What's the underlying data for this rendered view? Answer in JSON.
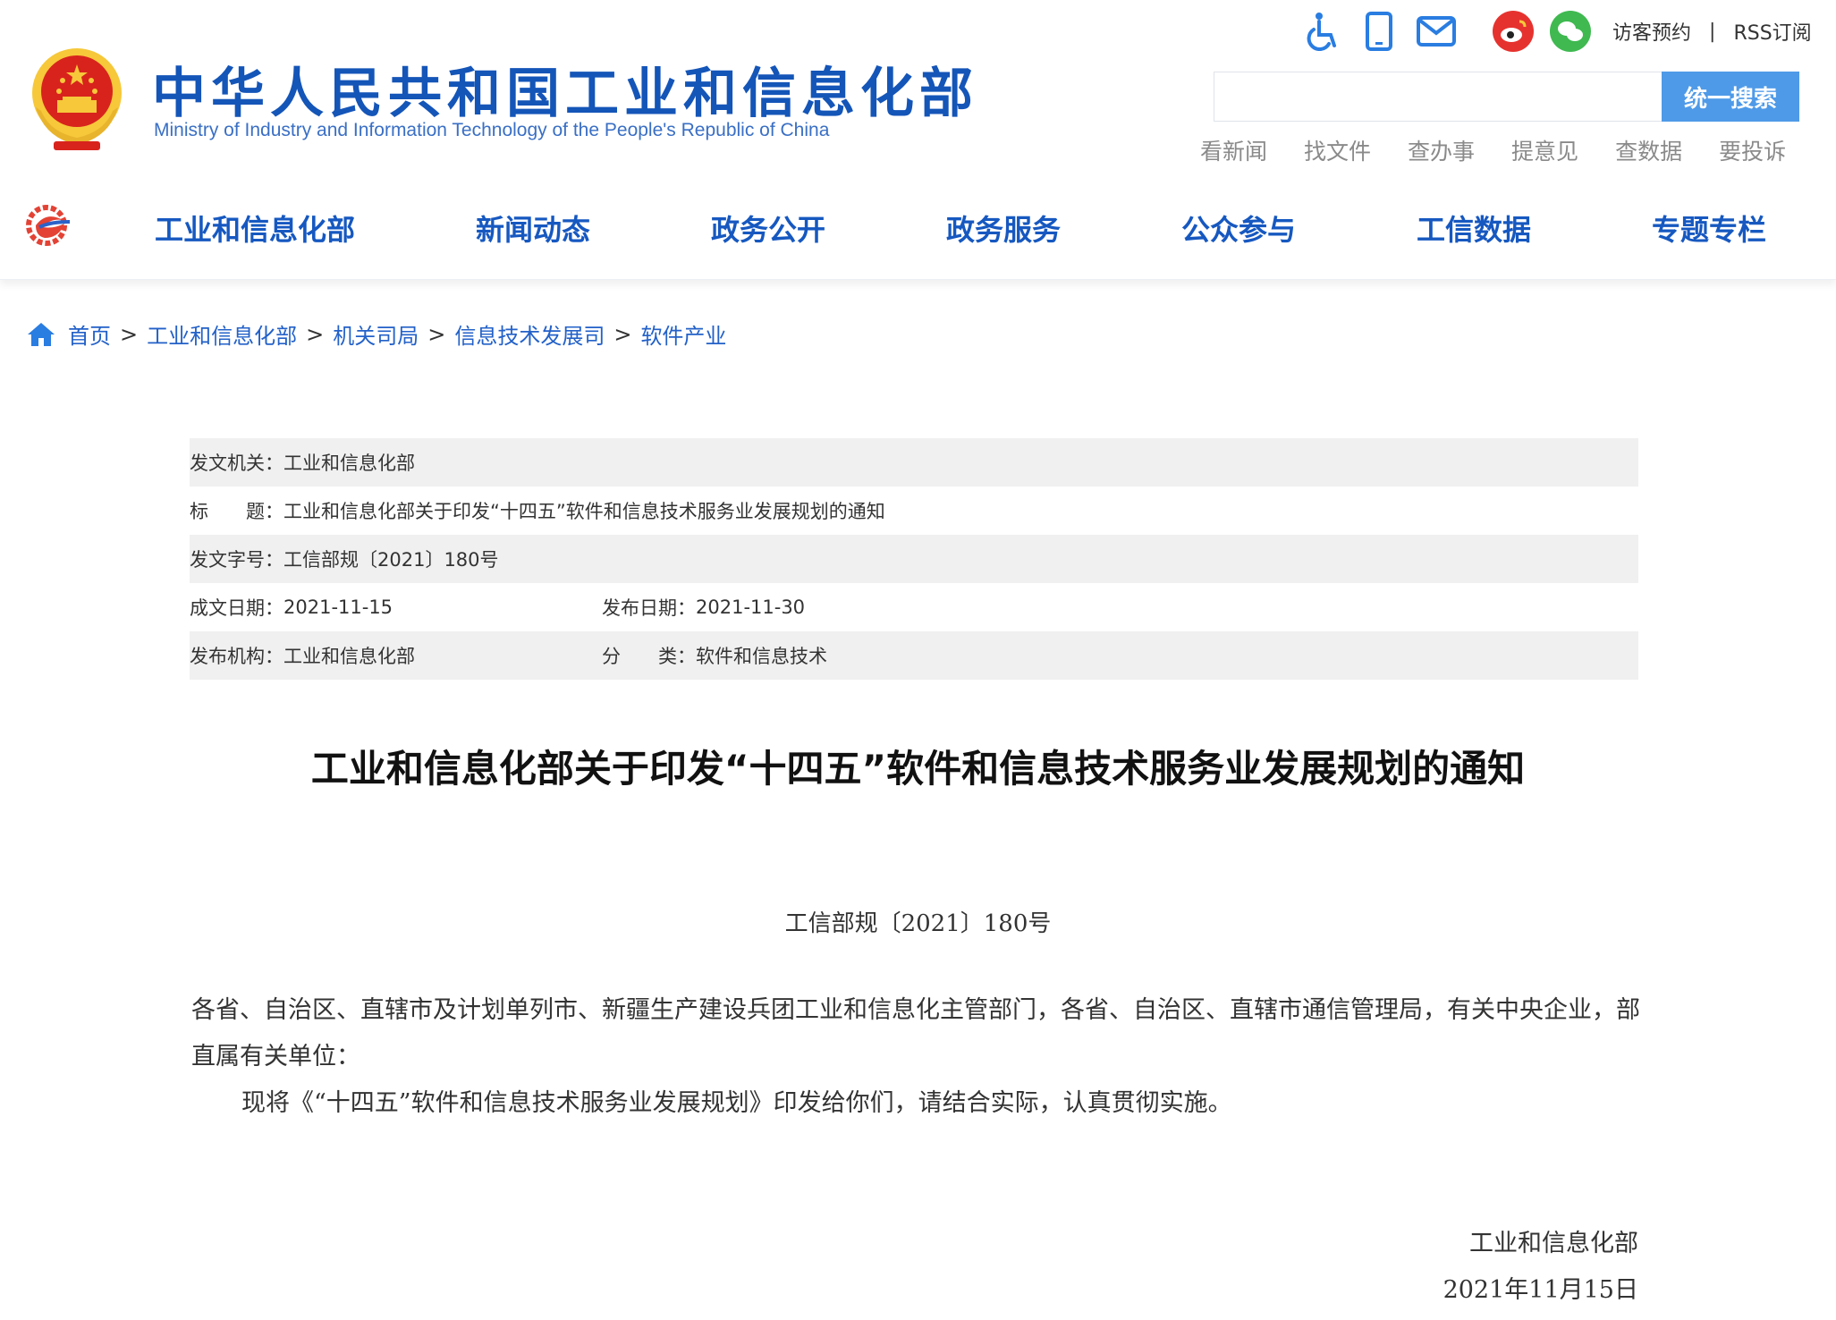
{
  "header": {
    "title": "中华人民共和国工业和信息化部",
    "subtitle": "Ministry of Industry and Information Technology of the People's Republic of China",
    "util_icons": [
      "accessibility-icon",
      "mobile-icon",
      "mail-icon",
      "weibo-icon",
      "wechat-icon"
    ],
    "visitor_label": "访客预约",
    "separator": "|",
    "rss_label": "RSS订阅",
    "search_placeholder": "",
    "search_button": "统一搜索",
    "quick_links": [
      "看新闻",
      "找文件",
      "查办事",
      "提意见",
      "查数据",
      "要投诉"
    ]
  },
  "nav": {
    "items": [
      "工业和信息化部",
      "新闻动态",
      "政务公开",
      "政务服务",
      "公众参与",
      "工信数据",
      "专题专栏"
    ]
  },
  "breadcrumb": {
    "items": [
      "首页",
      "工业和信息化部",
      "机关司局",
      "信息技术发展司",
      "软件产业"
    ],
    "sep": ">"
  },
  "meta": {
    "issuer_label": "发文机关：",
    "issuer": "工业和信息化部",
    "title_label": "标　　题：",
    "title": "工业和信息化部关于印发“十四五”软件和信息技术服务业发展规划的通知",
    "docno_label": "发文字号：",
    "docno": "工信部规〔2021〕180号",
    "created_label": "成文日期：",
    "created": "2021-11-15",
    "published_label": "发布日期：",
    "published": "2021-11-30",
    "org_label": "发布机构：",
    "org": "工业和信息化部",
    "category_label": "分　　类：",
    "category": "软件和信息技术"
  },
  "article": {
    "title": "工业和信息化部关于印发“十四五”软件和信息技术服务业发展规划的通知",
    "doc_number": "工信部规〔2021〕180号",
    "addressee": "各省、自治区、直辖市及计划单列市、新疆生产建设兵团工业和信息化主管部门，各省、自治区、直辖市通信管理局，有关中央企业，部直属有关单位：",
    "paragraph": "现将《“十四五”软件和信息技术服务业发展规划》印发给你们，请结合实际，认真贯彻实施。",
    "signature_org": "工业和信息化部",
    "signature_date": "2021年11月15日"
  },
  "colors": {
    "brand_blue": "#1455b8",
    "nav_blue": "#1658c0",
    "search_button": "#4e9ae8",
    "emblem_red": "#d8231d",
    "emblem_gold": "#f6c83a"
  }
}
